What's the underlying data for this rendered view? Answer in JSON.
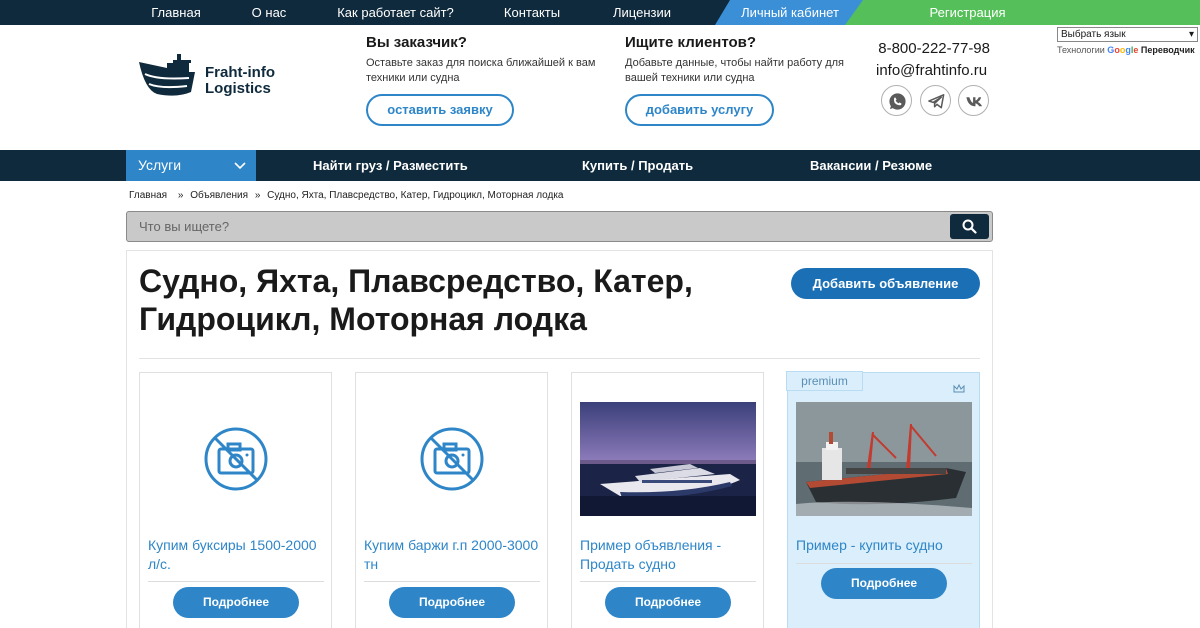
{
  "topnav": {
    "home": "Главная",
    "about": "О нас",
    "how": "Как работает сайт?",
    "contacts": "Контакты",
    "licenses": "Лицензии",
    "cabinet": "Личный кабинет",
    "register": "Регистрация"
  },
  "logo": {
    "line1": "Fraht-info",
    "line2": "Logistics"
  },
  "customer": {
    "title": "Вы заказчик?",
    "text": "Оставьте заказ для поиска ближайшей к вам техники или судна",
    "button": "оставить заявку"
  },
  "clients": {
    "title": "Ищите клиентов?",
    "text": "Добавьте данные, чтобы найти работу для вашей техники или судна",
    "button": "добавить услугу"
  },
  "contacts": {
    "phone": "8-800-222-77-98",
    "email": "info@frahtinfo.ru"
  },
  "social": [
    "whatsapp-icon",
    "telegram-icon",
    "vk-icon"
  ],
  "lang": {
    "select": "Выбрать язык",
    "powered": "Технологии",
    "google": "Google",
    "translate": "Переводчик"
  },
  "nav": {
    "services": "Услуги",
    "find": "Найти груз / Разместить",
    "buy": "Купить / Продать",
    "jobs": "Вакансии / Резюме"
  },
  "breadcrumb": {
    "home": "Главная",
    "ads": "Объявления",
    "current": "Судно, Яхта, Плавсредство, Катер, Гидроцикл, Моторная лодка"
  },
  "search": {
    "placeholder": "Что вы ищете?"
  },
  "page": {
    "title": "Судно, Яхта, Плавсредство, Катер, Гидроцикл, Моторная лодка",
    "add_button": "Добавить объявление"
  },
  "cards": [
    {
      "title": "Купим буксиры 1500-2000 л/с.",
      "button": "Подробнее",
      "image": "no-photo-icon"
    },
    {
      "title": "Купим баржи г.п 2000-3000 тн",
      "button": "Подробнее",
      "image": "no-photo-icon"
    },
    {
      "title": "Пример объявления - Продать судно",
      "button": "Подробнее",
      "image": "yacht-photo"
    },
    {
      "title": "Пример - купить судно",
      "button": "Подробнее",
      "image": "cargo-ship-photo",
      "badge": "premium"
    }
  ],
  "colors": {
    "dark": "#0f2a3c",
    "accent": "#2e86c8",
    "green": "#55c05a",
    "premium_bg": "#dbeefb"
  }
}
